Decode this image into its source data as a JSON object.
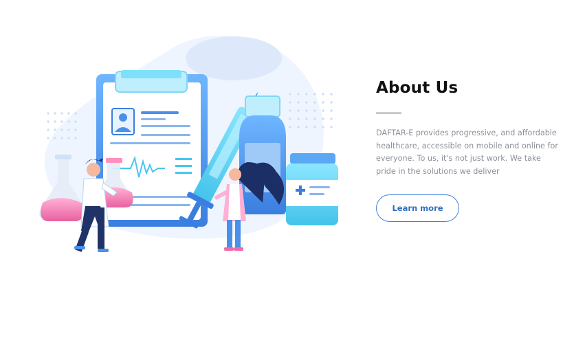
{
  "about": {
    "title": "About Us",
    "description": "DAFTAR-E provides progressive, and affordable healthcare, accessible on mobile and online for everyone. To us, it's not just work. We take pride in the solutions we deliver",
    "button_label": "Learn more"
  },
  "illustration": {
    "subject": "doctors-clipboard-medicine-icon"
  },
  "colors": {
    "accent": "#3f84d8",
    "heading": "#111111",
    "body_text": "#8b8f98",
    "illustration_blue": "#4a90e8",
    "illustration_pink": "#f08bbf",
    "illustration_cyan": "#5bd3f0"
  }
}
